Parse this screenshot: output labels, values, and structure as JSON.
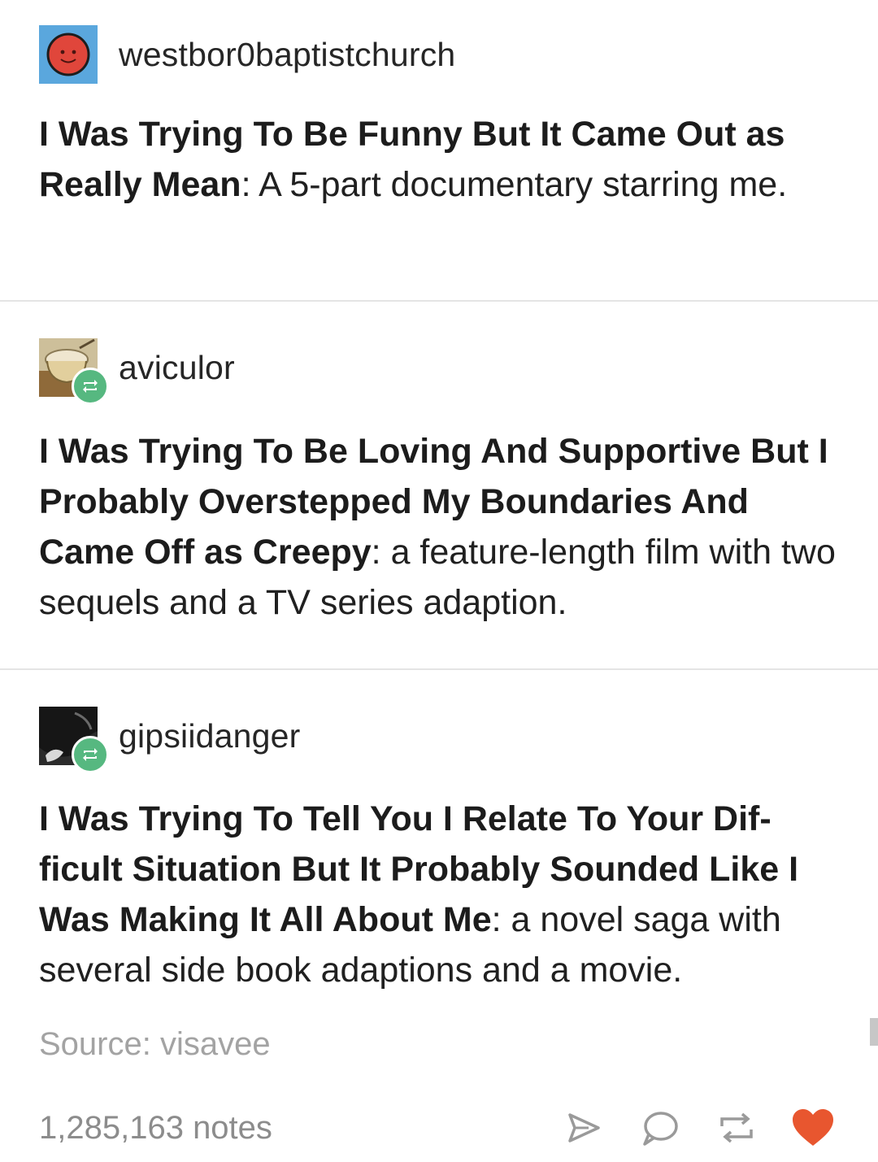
{
  "posts": [
    {
      "username": "westbor0baptistchurch",
      "avatar": "red-smiley-avatar-icon",
      "bold": "I Was Trying To Be Funny But It Came Out as Really Mean",
      "rest": ": A 5-part documentary starring me."
    },
    {
      "username": "aviculor",
      "avatar": "cup-photo-avatar",
      "reblog_icon": "reblog-icon",
      "bold": "I Was Trying To Be Loving And Supportive But I Probably Overstepped My Boundaries And Came Off as Creepy",
      "rest": ": a feature-length film with two sequels and a TV series adaption."
    },
    {
      "username": "gipsiidanger",
      "avatar": "dark-photo-avatar",
      "reblog_icon": "reblog-icon",
      "bold": "I Was Trying To Tell You I Relate To Your Dif-ficult Situation But It Probably Sounded Like I Was Making It All About Me",
      "rest": ": a novel saga with several side book adaptions and a movie."
    }
  ],
  "footer": {
    "source": "Source: visavee",
    "notes": "1,285,163 notes",
    "actions": [
      "share-icon",
      "reply-icon",
      "reblog-icon",
      "like-icon"
    ]
  },
  "colors": {
    "reblog_green": "#56b880",
    "like_red": "#e8562f",
    "avatar_blue": "#5aa7dd",
    "avatar_red": "#e0463b"
  }
}
